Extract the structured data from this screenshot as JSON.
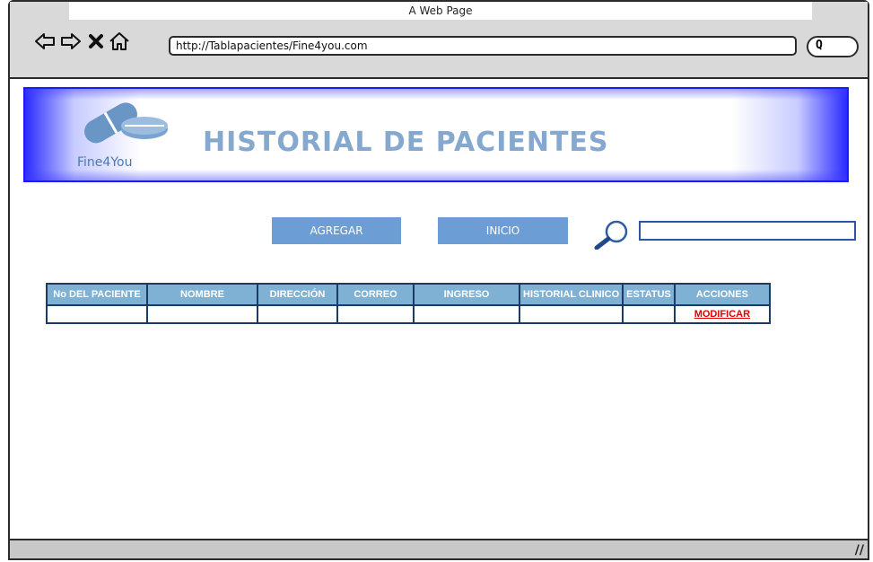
{
  "window": {
    "title": "A Web Page"
  },
  "browser": {
    "url": "http://Tablapacientes/Fine4you.com",
    "search_glyph": "Q",
    "icons": [
      "back-arrow-icon",
      "forward-arrow-icon",
      "stop-icon",
      "home-icon",
      "magnifier-icon",
      "resize-grip-icon"
    ]
  },
  "banner": {
    "logo_text": "Fine4You",
    "title": "HISTORIAL DE PACIENTES"
  },
  "actions": {
    "add_label": "AGREGAR",
    "home_label": "INICIO",
    "search_value": ""
  },
  "table": {
    "headers": [
      "No DEL PACIENTE",
      "NOMBRE",
      "DIRECCIÓN",
      "CORREO",
      "INGRESO",
      "HISTORIAL CLINICO",
      "ESTATUS",
      "ACCIONES"
    ],
    "rows": [
      {
        "cells": [
          "",
          "",
          "",
          "",
          "",
          "",
          ""
        ],
        "action_label": "MODIFICAR"
      }
    ]
  },
  "status_bar": {
    "grip": "//"
  },
  "colors": {
    "button_bg": "#6d9dd5",
    "header_bg": "#7fb1d4",
    "title_color": "#85a8cf",
    "banner_edge": "#2a2aff",
    "link_color": "#e00000"
  }
}
